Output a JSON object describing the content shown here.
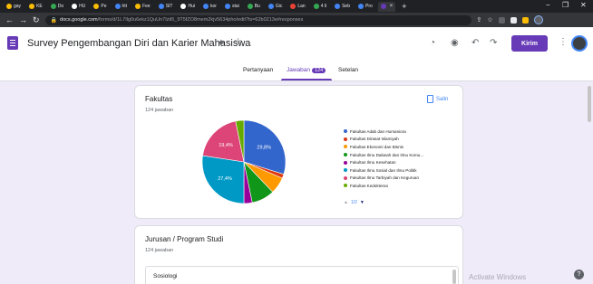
{
  "browser": {
    "tabs": [
      {
        "label": "gay",
        "color": "#fbbc04"
      },
      {
        "label": "KE",
        "color": "#fbbc04"
      },
      {
        "label": "Do",
        "color": "#34a853"
      },
      {
        "label": "HU",
        "color": "#ffffff"
      },
      {
        "label": "Pe",
        "color": "#fbbc04"
      },
      {
        "label": "htt",
        "color": "#4285f4"
      },
      {
        "label": "Fee",
        "color": "#fbbc04"
      },
      {
        "label": "SIT",
        "color": "#4285f4"
      },
      {
        "label": "Hui",
        "color": "#ffffff"
      },
      {
        "label": "kor",
        "color": "#4285f4"
      },
      {
        "label": "stai",
        "color": "#4285f4"
      },
      {
        "label": "Bu",
        "color": "#34a853"
      },
      {
        "label": "Gic",
        "color": "#4285f4"
      },
      {
        "label": "Lan",
        "color": "#ea4335"
      },
      {
        "label": "4 li",
        "color": "#34a853"
      },
      {
        "label": "Seb",
        "color": "#4285f4"
      },
      {
        "label": "Pro",
        "color": "#4285f4"
      },
      {
        "label": "",
        "color": "#673ab7",
        "active": true
      }
    ],
    "new_tab": "+",
    "url_domain": "docs.google.com",
    "url_path": "/forms/d/1L7Ilg0u6ekz1QuUn7Izti5_9T5fZO8mem2kjv5634pho/edit?ts=62b0213e#responses",
    "window_controls": {
      "minimize": "−",
      "restore": "❐",
      "close": "✕"
    }
  },
  "form": {
    "title": "Survey Pengembangan Diri dan Karier Mahasiswa",
    "send_label": "Kirim",
    "tabs": {
      "questions": "Pertanyaan",
      "responses": "Jawaban",
      "responses_count": "124",
      "settings": "Setelan"
    }
  },
  "card1": {
    "title": "Fakultas",
    "subtitle": "124 jawaban",
    "copy_label": "Salin",
    "pager": "1/2"
  },
  "chart_data": {
    "type": "pie",
    "title": "Fakultas",
    "labels": [
      "Fakultas Adab dan Humaniora",
      "Fakultas Dirasat Islamiyah",
      "Fakultas Ekonomi dan Bisnis",
      "Fakultas Ilmu Dakwah dan Ilmu Komu...",
      "Fakultas Ilmu Kesehatan",
      "Fakultas Ilmu Sosial dan Ilmu Politik",
      "Fakultas Ilmu Tarbiyah dan Keguruan",
      "Fakultas Kedokteran"
    ],
    "values": [
      29.8,
      1.6,
      6.5,
      8.9,
      3.2,
      27.4,
      19.4,
      3.2
    ],
    "slice_labels": [
      "29,8%",
      "",
      "",
      "",
      "",
      "27,4%",
      "19,4%",
      ""
    ],
    "colors": [
      "#3366cc",
      "#dc3912",
      "#ff9900",
      "#109618",
      "#990099",
      "#0099c6",
      "#dd4477",
      "#66aa00"
    ],
    "legend_position": "right"
  },
  "card2": {
    "title": "Jurusan / Program Studi",
    "subtitle": "124 jawaban",
    "first_item": "Sosiologi"
  },
  "os": {
    "watermark": "Activate Windows",
    "help": "?"
  }
}
